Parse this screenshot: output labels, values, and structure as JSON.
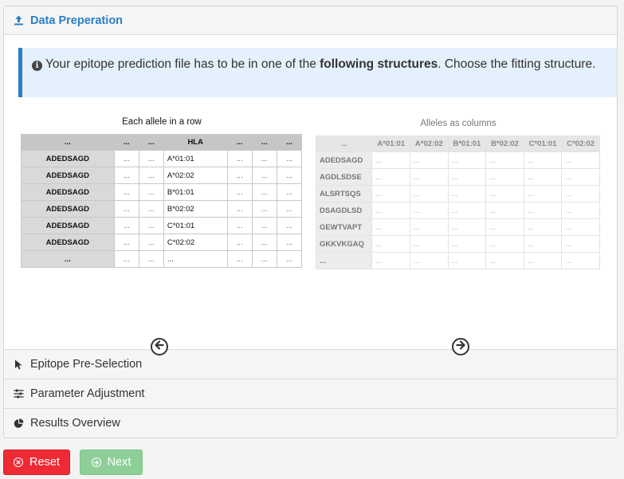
{
  "panels": {
    "data_preparation": "Data Preperation",
    "epitope_preselection": "Epitope Pre-Selection",
    "parameter_adjustment": "Parameter Adjustment",
    "results_overview": "Results Overview"
  },
  "info": {
    "prefix": "Your epitope prediction file has to be in one of the ",
    "bold": "following structures",
    "suffix": ". Choose the fitting structure."
  },
  "figure_rows": {
    "title": "Each allele in a row",
    "header": [
      "...",
      "...",
      "...",
      "HLA",
      "...",
      "...",
      "..."
    ],
    "rows": [
      {
        "seq": "ADEDSAGD",
        "hla": "A*01:01"
      },
      {
        "seq": "ADEDSAGD",
        "hla": "A*02:02"
      },
      {
        "seq": "ADEDSAGD",
        "hla": "B*01:01"
      },
      {
        "seq": "ADEDSAGD",
        "hla": "B*02:02"
      },
      {
        "seq": "ADEDSAGD",
        "hla": "C*01:01"
      },
      {
        "seq": "ADEDSAGD",
        "hla": "C*02:02"
      },
      {
        "seq": "...",
        "hla": "..."
      }
    ],
    "filler": "..."
  },
  "figure_columns": {
    "title": "Alleles as columns",
    "header": [
      "...",
      "A*01:01",
      "A*02:02",
      "B*01:01",
      "B*02:02",
      "C*01:01",
      "C*02:02"
    ],
    "rows": [
      "ADEDSAGD",
      "AGDLSDSE",
      "ALSRTSQS",
      "DSAGDLSD",
      "GEWTVAPT",
      "GKKVKGAQ",
      "..."
    ],
    "filler": "..."
  },
  "buttons": {
    "reset": "Reset",
    "next": "Next"
  },
  "colors": {
    "accent": "#2a7ec2",
    "reset": "#ee2a35",
    "next": "#8ecf98",
    "info_bg": "#e4f0fb"
  }
}
